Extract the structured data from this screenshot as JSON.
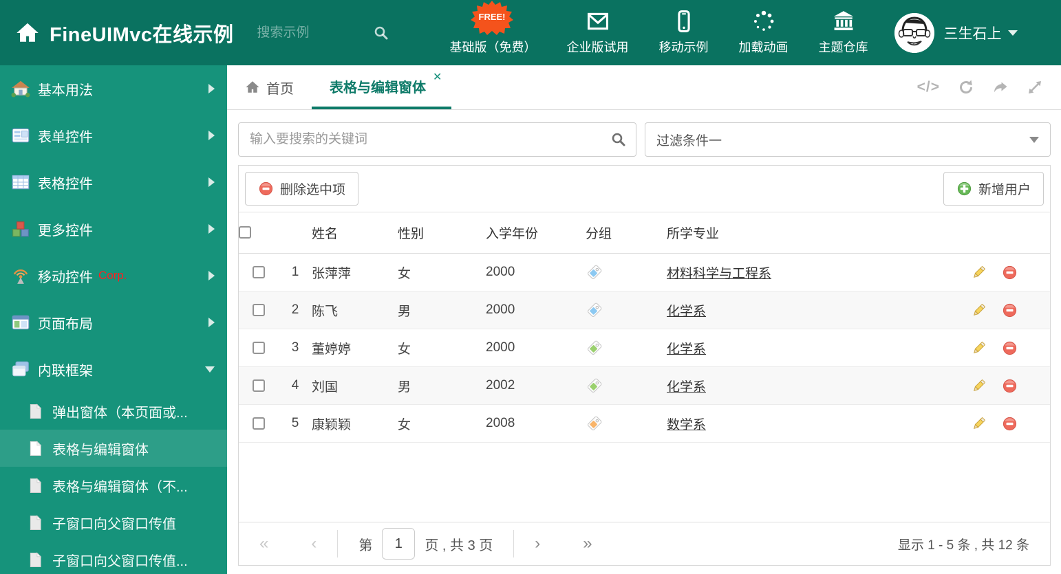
{
  "colors": {
    "header_bg": "#0a7260",
    "sidebar_bg": "#16937b",
    "sidebar_active_bg": "#2d9e88",
    "accent": "#0d7a68",
    "free_badge": "#f4531c",
    "delete_red": "#ee6a5c",
    "add_green": "#67b857",
    "pencil_yellow": "#f7d45c"
  },
  "header": {
    "title": "FineUIMvc在线示例",
    "search_placeholder": "搜索示例",
    "free_badge": "FREE!",
    "nav": [
      {
        "icon": "download-icon",
        "label": "基础版（免费）"
      },
      {
        "icon": "envelope-icon",
        "label": "企业版试用"
      },
      {
        "icon": "mobile-icon",
        "label": "移动示例"
      },
      {
        "icon": "spinner-icon",
        "label": "加载动画"
      },
      {
        "icon": "bank-icon",
        "label": "主题仓库"
      }
    ],
    "user": {
      "name": "三生石上"
    }
  },
  "sidebar": {
    "items": [
      {
        "icon": "house-icon",
        "label": "基本用法"
      },
      {
        "icon": "form-icon",
        "label": "表单控件"
      },
      {
        "icon": "table-icon",
        "label": "表格控件"
      },
      {
        "icon": "cubes-icon",
        "label": "更多控件"
      },
      {
        "icon": "antenna-icon",
        "label": "移动控件",
        "badge": "Corp."
      },
      {
        "icon": "layout-icon",
        "label": "页面布局"
      },
      {
        "icon": "frames-icon",
        "label": "内联框架"
      }
    ],
    "subitems": [
      {
        "label": "弹出窗体（本页面或..."
      },
      {
        "label": "表格与编辑窗体",
        "active": true
      },
      {
        "label": "表格与编辑窗体（不..."
      },
      {
        "label": "子窗口向父窗口传值"
      },
      {
        "label": "子窗口向父窗口传值..."
      }
    ]
  },
  "tabs": {
    "home": "首页",
    "active": "表格与编辑窗体"
  },
  "filters": {
    "search_placeholder": "输入要搜索的关键词",
    "filter_value": "过滤条件一"
  },
  "toolbar": {
    "delete_label": "删除选中项",
    "add_label": "新增用户"
  },
  "table": {
    "columns": [
      "姓名",
      "性别",
      "入学年份",
      "分组",
      "所学专业"
    ],
    "rows": [
      {
        "num": "1",
        "name": "张萍萍",
        "gender": "女",
        "year": "2000",
        "tag_color": "#8cc9f2",
        "major": "材料科学与工程系"
      },
      {
        "num": "2",
        "name": "陈飞",
        "gender": "男",
        "year": "2000",
        "tag_color": "#8cc9f2",
        "major": "化学系"
      },
      {
        "num": "3",
        "name": "董婷婷",
        "gender": "女",
        "year": "2000",
        "tag_color": "#9ad06e",
        "major": "化学系"
      },
      {
        "num": "4",
        "name": "刘国",
        "gender": "男",
        "year": "2002",
        "tag_color": "#9ad06e",
        "major": "化学系"
      },
      {
        "num": "5",
        "name": "康颖颖",
        "gender": "女",
        "year": "2008",
        "tag_color": "#f8b46a",
        "major": "数学系"
      }
    ]
  },
  "pagination": {
    "first": "«",
    "prev": "‹",
    "prefix": "第",
    "page": "1",
    "suffix": "页 , 共 3 页",
    "next": "›",
    "last": "»",
    "info": "显示 1 - 5 条 , 共 12 条"
  }
}
